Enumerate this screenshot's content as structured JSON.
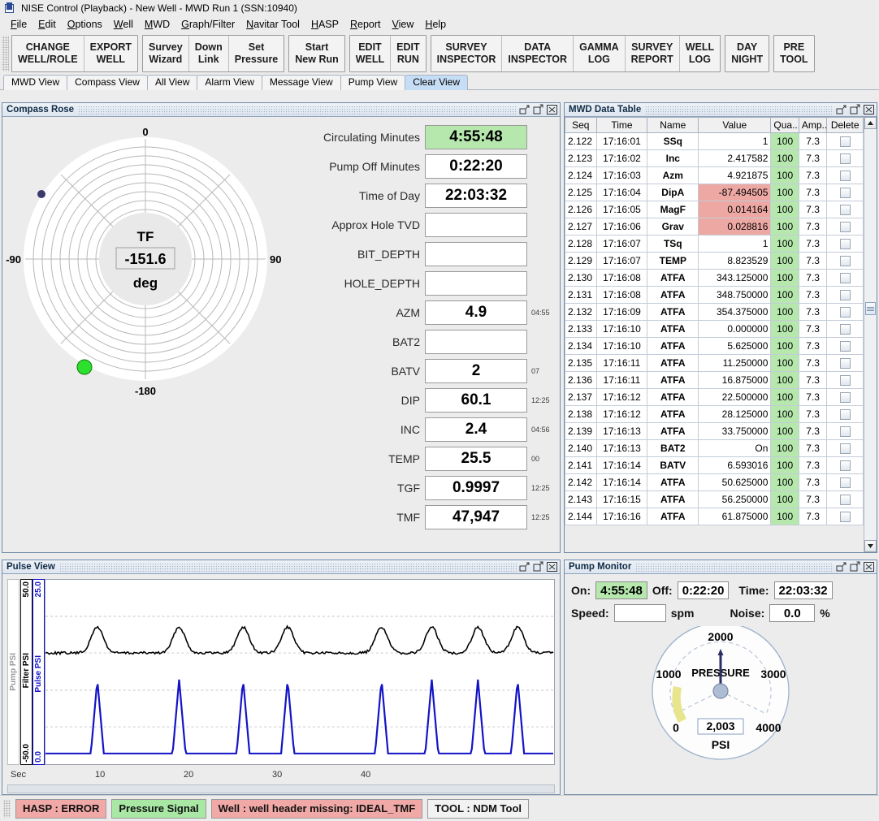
{
  "window": {
    "title": "NISE Control  (Playback)  -   New Well  -  MWD Run 1      (SSN:10940)"
  },
  "menu": {
    "items": [
      {
        "label": "File",
        "mnemonic": "F"
      },
      {
        "label": "Edit",
        "mnemonic": "E"
      },
      {
        "label": "Options",
        "mnemonic": "O"
      },
      {
        "label": "Well",
        "mnemonic": "W"
      },
      {
        "label": "MWD",
        "mnemonic": "M"
      },
      {
        "label": "Graph/Filter",
        "mnemonic": "G"
      },
      {
        "label": "Navitar Tool",
        "mnemonic": "N"
      },
      {
        "label": "HASP",
        "mnemonic": "H"
      },
      {
        "label": "Report",
        "mnemonic": "R"
      },
      {
        "label": "View",
        "mnemonic": "V"
      },
      {
        "label": "Help",
        "mnemonic": "H"
      }
    ]
  },
  "toolbar": {
    "groups": [
      {
        "buttons": [
          {
            "line1": "CHANGE",
            "line2": "WELL/ROLE"
          },
          {
            "line1": "EXPORT",
            "line2": "WELL"
          }
        ]
      },
      {
        "buttons": [
          {
            "line1": "Survey",
            "line2": "Wizard"
          },
          {
            "line1": "Down",
            "line2": "Link"
          },
          {
            "line1": "Set",
            "line2": "Pressure"
          }
        ]
      },
      {
        "buttons": [
          {
            "line1": "Start",
            "line2": "New Run"
          }
        ]
      },
      {
        "buttons": [
          {
            "line1": "EDIT",
            "line2": "WELL"
          },
          {
            "line1": "EDIT",
            "line2": "RUN"
          }
        ]
      },
      {
        "buttons": [
          {
            "line1": "SURVEY",
            "line2": "INSPECTOR"
          },
          {
            "line1": "DATA",
            "line2": "INSPECTOR"
          },
          {
            "line1": "GAMMA",
            "line2": "LOG"
          },
          {
            "line1": "SURVEY",
            "line2": "REPORT"
          },
          {
            "line1": "WELL",
            "line2": "LOG"
          }
        ]
      },
      {
        "buttons": [
          {
            "line1": "DAY",
            "line2": "NIGHT"
          }
        ]
      },
      {
        "buttons": [
          {
            "line1": "PRE",
            "line2": "TOOL"
          }
        ]
      }
    ]
  },
  "view_tabs": {
    "items": [
      {
        "label": "MWD View",
        "active": false
      },
      {
        "label": "Compass View",
        "active": false
      },
      {
        "label": "All View",
        "active": false
      },
      {
        "label": "Alarm View",
        "active": false
      },
      {
        "label": "Message View",
        "active": false
      },
      {
        "label": "Pump View",
        "active": false
      },
      {
        "label": "Clear View",
        "active": true
      }
    ]
  },
  "compass_panel": {
    "title": "Compass Rose",
    "rose": {
      "center_label": "TF",
      "center_value": "-151.6",
      "center_unit": "deg",
      "tick_top": "0",
      "tick_left": "-90",
      "tick_right": "90",
      "tick_bottom": "-180"
    },
    "fields": [
      {
        "label": "Circulating Minutes",
        "value": "4:55:48",
        "stamp": "",
        "highlight": true
      },
      {
        "label": "Pump Off Minutes",
        "value": "0:22:20",
        "stamp": "",
        "highlight": false
      },
      {
        "label": "Time of Day",
        "value": "22:03:32",
        "stamp": "",
        "highlight": false
      },
      {
        "label": "Approx Hole TVD",
        "value": "",
        "stamp": "",
        "highlight": false
      },
      {
        "label": "BIT_DEPTH",
        "value": "",
        "stamp": "",
        "highlight": false
      },
      {
        "label": "HOLE_DEPTH",
        "value": "",
        "stamp": "",
        "highlight": false
      },
      {
        "label": "AZM",
        "value": "4.9",
        "stamp": "04:55",
        "highlight": false
      },
      {
        "label": "BAT2",
        "value": "",
        "stamp": "",
        "highlight": false
      },
      {
        "label": "BATV",
        "value": "2",
        "stamp": "07",
        "highlight": false
      },
      {
        "label": "DIP",
        "value": "60.1",
        "stamp": "12:25",
        "highlight": false
      },
      {
        "label": "INC",
        "value": "2.4",
        "stamp": "04:56",
        "highlight": false
      },
      {
        "label": "TEMP",
        "value": "25.5",
        "stamp": "00",
        "highlight": false
      },
      {
        "label": "TGF",
        "value": "0.9997",
        "stamp": "12:25",
        "highlight": false
      },
      {
        "label": "TMF",
        "value": "47,947",
        "stamp": "12:25",
        "highlight": false
      }
    ]
  },
  "mwd_table": {
    "title": "MWD Data Table",
    "columns": [
      "Seq",
      "Time",
      "Name",
      "Value",
      "Qua...",
      "Amp...",
      "Delete"
    ],
    "rows": [
      {
        "seq": "2.122",
        "time": "17:16:01",
        "name": "SSq",
        "value": "1",
        "qua": "100",
        "amp": "7.3",
        "flag": false
      },
      {
        "seq": "2.123",
        "time": "17:16:02",
        "name": "Inc",
        "value": "2.417582",
        "qua": "100",
        "amp": "7.3",
        "flag": false
      },
      {
        "seq": "2.124",
        "time": "17:16:03",
        "name": "Azm",
        "value": "4.921875",
        "qua": "100",
        "amp": "7.3",
        "flag": false
      },
      {
        "seq": "2.125",
        "time": "17:16:04",
        "name": "DipA",
        "value": "-87.494505",
        "qua": "100",
        "amp": "7.3",
        "flag": true
      },
      {
        "seq": "2.126",
        "time": "17:16:05",
        "name": "MagF",
        "value": "0.014164",
        "qua": "100",
        "amp": "7.3",
        "flag": true
      },
      {
        "seq": "2.127",
        "time": "17:16:06",
        "name": "Grav",
        "value": "0.028816",
        "qua": "100",
        "amp": "7.3",
        "flag": true
      },
      {
        "seq": "2.128",
        "time": "17:16:07",
        "name": "TSq",
        "value": "1",
        "qua": "100",
        "amp": "7.3",
        "flag": false
      },
      {
        "seq": "2.129",
        "time": "17:16:07",
        "name": "TEMP",
        "value": "8.823529",
        "qua": "100",
        "amp": "7.3",
        "flag": false
      },
      {
        "seq": "2.130",
        "time": "17:16:08",
        "name": "ATFA",
        "value": "343.125000",
        "qua": "100",
        "amp": "7.3",
        "flag": false
      },
      {
        "seq": "2.131",
        "time": "17:16:08",
        "name": "ATFA",
        "value": "348.750000",
        "qua": "100",
        "amp": "7.3",
        "flag": false
      },
      {
        "seq": "2.132",
        "time": "17:16:09",
        "name": "ATFA",
        "value": "354.375000",
        "qua": "100",
        "amp": "7.3",
        "flag": false
      },
      {
        "seq": "2.133",
        "time": "17:16:10",
        "name": "ATFA",
        "value": "0.000000",
        "qua": "100",
        "amp": "7.3",
        "flag": false
      },
      {
        "seq": "2.134",
        "time": "17:16:10",
        "name": "ATFA",
        "value": "5.625000",
        "qua": "100",
        "amp": "7.3",
        "flag": false
      },
      {
        "seq": "2.135",
        "time": "17:16:11",
        "name": "ATFA",
        "value": "11.250000",
        "qua": "100",
        "amp": "7.3",
        "flag": false
      },
      {
        "seq": "2.136",
        "time": "17:16:11",
        "name": "ATFA",
        "value": "16.875000",
        "qua": "100",
        "amp": "7.3",
        "flag": false
      },
      {
        "seq": "2.137",
        "time": "17:16:12",
        "name": "ATFA",
        "value": "22.500000",
        "qua": "100",
        "amp": "7.3",
        "flag": false
      },
      {
        "seq": "2.138",
        "time": "17:16:12",
        "name": "ATFA",
        "value": "28.125000",
        "qua": "100",
        "amp": "7.3",
        "flag": false
      },
      {
        "seq": "2.139",
        "time": "17:16:13",
        "name": "ATFA",
        "value": "33.750000",
        "qua": "100",
        "amp": "7.3",
        "flag": false
      },
      {
        "seq": "2.140",
        "time": "17:16:13",
        "name": "BAT2",
        "value": "On",
        "qua": "100",
        "amp": "7.3",
        "flag": false
      },
      {
        "seq": "2.141",
        "time": "17:16:14",
        "name": "BATV",
        "value": "6.593016",
        "qua": "100",
        "amp": "7.3",
        "flag": false
      },
      {
        "seq": "2.142",
        "time": "17:16:14",
        "name": "ATFA",
        "value": "50.625000",
        "qua": "100",
        "amp": "7.3",
        "flag": false
      },
      {
        "seq": "2.143",
        "time": "17:16:15",
        "name": "ATFA",
        "value": "56.250000",
        "qua": "100",
        "amp": "7.3",
        "flag": false
      },
      {
        "seq": "2.144",
        "time": "17:16:16",
        "name": "ATFA",
        "value": "61.875000",
        "qua": "100",
        "amp": "7.3",
        "flag": false
      }
    ]
  },
  "pulse_view": {
    "title": "Pulse View",
    "axes": {
      "pump": {
        "name": "Pump PSI",
        "color": "#9a9a9a",
        "top": "",
        "bottom": ""
      },
      "filter": {
        "name": "Filter PSI",
        "color": "#000000",
        "top": "50.0",
        "bottom": "-50.0"
      },
      "pulse": {
        "name": "Pulse PSI",
        "color": "#1313c8",
        "top": "25.0",
        "bottom": "0.0"
      }
    },
    "xaxis": {
      "label": "Sec",
      "ticks": [
        "10",
        "20",
        "30",
        "40"
      ]
    }
  },
  "pump_monitor": {
    "title": "Pump Monitor",
    "on_label": "On:",
    "on_value": "4:55:48",
    "off_label": "Off:",
    "off_value": "0:22:20",
    "time_label": "Time:",
    "time_value": "22:03:32",
    "speed_label": "Speed:",
    "speed_value": "",
    "speed_unit": "spm",
    "noise_label": "Noise:",
    "noise_value": "0.0",
    "noise_unit": "%",
    "gauge": {
      "caption": "PRESSURE",
      "unit": "PSI",
      "value": "2,003",
      "ticks": [
        "0",
        "1000",
        "2000",
        "3000",
        "4000"
      ]
    }
  },
  "statusbar": {
    "items": [
      {
        "label": "HASP : ERROR",
        "style": "red"
      },
      {
        "label": "Pressure Signal",
        "style": "green"
      },
      {
        "label": "Well : well header missing: IDEAL_TMF",
        "style": "red"
      },
      {
        "label": "TOOL : NDM Tool",
        "style": "plain"
      }
    ]
  },
  "colors": {
    "ok_green": "#b6e8ae",
    "alarm_red": "#eda8a4",
    "accent_blue": "#1313c8",
    "tab_active": "#c5ddf5"
  }
}
